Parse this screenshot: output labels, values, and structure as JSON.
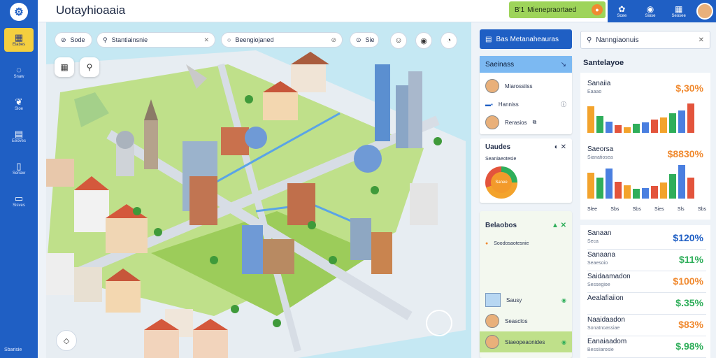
{
  "app_title": "Uotayhioaaia",
  "sidebar": {
    "items": [
      {
        "label": "Eiabes",
        "icon": "building-icon",
        "glyph": "▦"
      },
      {
        "label": "Snaw",
        "icon": "chat-icon",
        "glyph": "◌"
      },
      {
        "label": "Sloe",
        "icon": "leaf-icon",
        "glyph": "❦"
      },
      {
        "label": "Eeoves",
        "icon": "calendar-icon",
        "glyph": "▤"
      },
      {
        "label": "Senaw",
        "icon": "phone-icon",
        "glyph": "▯"
      },
      {
        "label": "Sisves",
        "icon": "card-icon",
        "glyph": "▭"
      }
    ],
    "footer": "Sbarisie"
  },
  "header": {
    "promo_text": "Mienepraortaed",
    "promo_prefix": "B'1",
    "buttons": [
      {
        "label": "Scee",
        "glyph": "✿"
      },
      {
        "label": "Siose",
        "glyph": "◉"
      },
      {
        "label": "Seosee",
        "glyph": "▦"
      }
    ]
  },
  "map_toolbar": {
    "filter_label": "Sode",
    "search_value": "Stantiainsnie",
    "location_value": "Beengiojaned",
    "small_label": "Sie"
  },
  "panel_mid": {
    "primary_button": "Bas Metanaheauras",
    "card1_title": "Saeinass",
    "people": [
      {
        "name": "Miarossiiss"
      },
      {
        "name": "Hanniss"
      },
      {
        "name": "Rerasios"
      }
    ],
    "card2_title": "Uaudes",
    "card2_sub": "Seaniaeotesie",
    "donut_label": "Sanee",
    "card3_title": "Belaobos",
    "card3_sub": "Soodosaotesnie",
    "list": [
      {
        "name": "Sausy"
      },
      {
        "name": "Seasclos"
      },
      {
        "name": "Siaeopeaonides"
      }
    ]
  },
  "panel_right": {
    "search_value": "Nanngiaonuis",
    "title": "Santelayoe",
    "top_stat": {
      "label": "Sanaiia",
      "sub": "Eaaao",
      "value": "$,30%"
    },
    "chart1_values": [
      70,
      45,
      30,
      20,
      15,
      25,
      28,
      35,
      40,
      52,
      60,
      78
    ],
    "mid_stat": {
      "label": "Saeorsa",
      "sub": "Sianatiosea",
      "value": "$8830%"
    },
    "chart2_values": [
      62,
      50,
      72,
      40,
      32,
      24,
      25,
      30,
      38,
      58,
      80,
      50
    ],
    "chart_colors": [
      "#f3a32c",
      "#2fae5a",
      "#4a7fe0",
      "#e3543c"
    ],
    "chart_labels": [
      "Slee",
      "Sbs",
      "Sbs",
      "Sies",
      "Sls",
      "Sbs"
    ],
    "stats": [
      {
        "label": "Sanaan",
        "sub": "Seca",
        "value": "$120%",
        "color": "#1f5fc4"
      },
      {
        "label": "Sanaana",
        "sub": "Seaesoio",
        "value": "$11%",
        "color": "#2fae5a"
      },
      {
        "label": "Saidaamadon",
        "sub": "Sessegioe",
        "value": "$100%",
        "color": "#f08a30"
      },
      {
        "label": "Aealafiaiion",
        "sub": "",
        "value": "$.35%",
        "color": "#2fae5a"
      },
      {
        "label": "Naaidaadon",
        "sub": "Sonatnoassiae",
        "value": "$83%",
        "color": "#f08a30"
      },
      {
        "label": "Eanaiaadom",
        "sub": "Bessiiarosie",
        "value": "$.98%",
        "color": "#2fae5a"
      }
    ]
  }
}
